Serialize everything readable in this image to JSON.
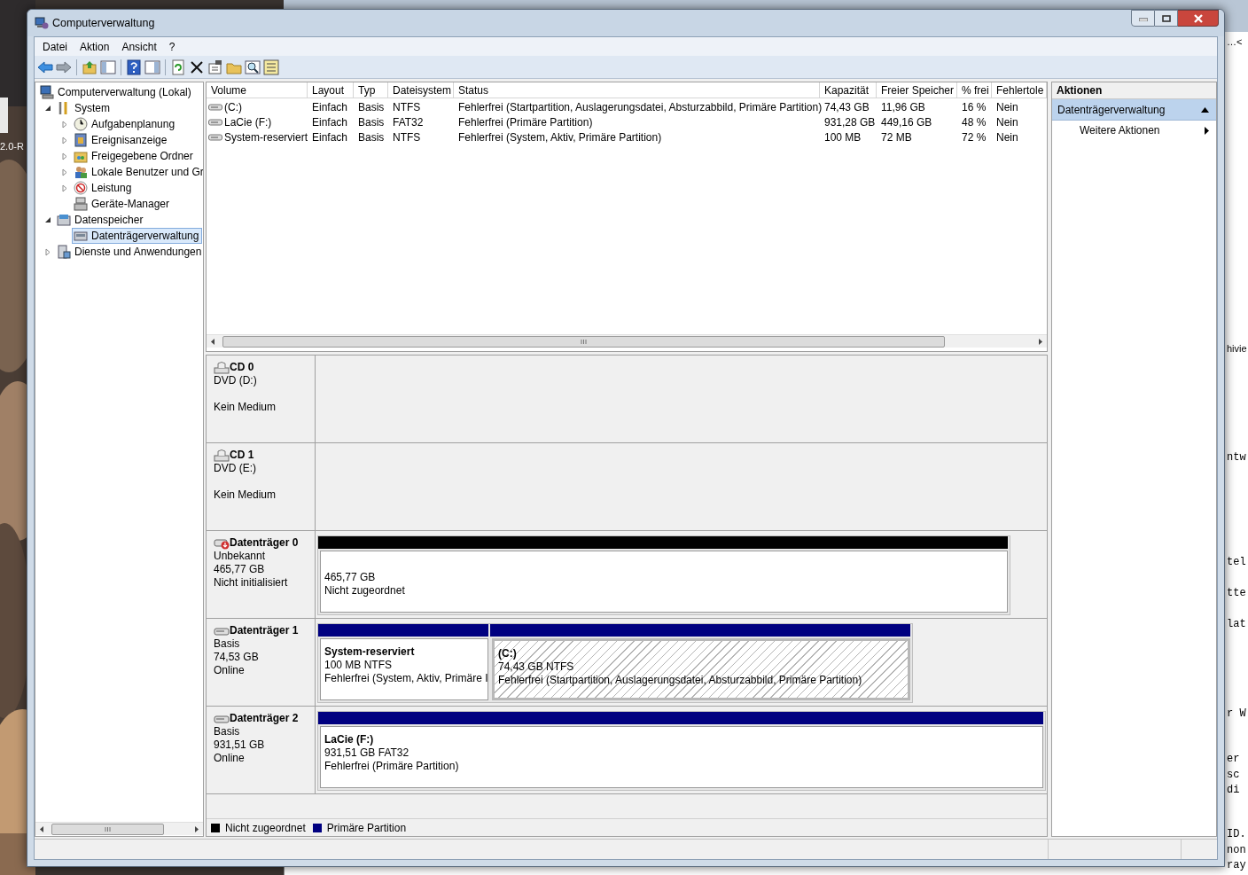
{
  "desktop": {
    "icon_label": "2.0-R"
  },
  "background_window": {
    "fragments": [
      "…<",
      "hivie",
      "ntw",
      "tel",
      "tte",
      "lat",
      "r W",
      "er",
      "sc",
      "di",
      "ID.",
      "non",
      "ray"
    ]
  },
  "window": {
    "title": "Computerverwaltung"
  },
  "menu": [
    "Datei",
    "Aktion",
    "Ansicht",
    "?"
  ],
  "tree": {
    "label": "Computerverwaltung (Lokal)",
    "selected": false,
    "children": [
      {
        "label": "System",
        "expanded": true,
        "selected": false,
        "children": [
          {
            "label": "Aufgabenplanung",
            "expanded": false,
            "selected": false
          },
          {
            "label": "Ereignisanzeige",
            "expanded": false,
            "selected": false
          },
          {
            "label": "Freigegebene Ordner",
            "expanded": false,
            "selected": false
          },
          {
            "label": "Lokale Benutzer und Gr",
            "expanded": false,
            "selected": false
          },
          {
            "label": "Leistung",
            "expanded": false,
            "selected": false
          },
          {
            "label": "Geräte-Manager",
            "selected": false
          }
        ]
      },
      {
        "label": "Datenspeicher",
        "expanded": true,
        "selected": false,
        "children": [
          {
            "label": "Datenträgerverwaltung",
            "selected": true
          }
        ]
      },
      {
        "label": "Dienste und Anwendungen",
        "expanded": false,
        "selected": false
      }
    ]
  },
  "table": {
    "columns": [
      "Volume",
      "Layout",
      "Typ",
      "Dateisystem",
      "Status",
      "Kapazität",
      "Freier Speicher",
      "% frei",
      "Fehlertole"
    ],
    "rows": [
      [
        "(C:)",
        "Einfach",
        "Basis",
        "NTFS",
        "Fehlerfrei (Startpartition, Auslagerungsdatei, Absturzabbild, Primäre Partition)",
        "74,43 GB",
        "11,96 GB",
        "16 %",
        "Nein"
      ],
      [
        "LaCie (F:)",
        "Einfach",
        "Basis",
        "FAT32",
        "Fehlerfrei (Primäre Partition)",
        "931,28 GB",
        "449,16 GB",
        "48 %",
        "Nein"
      ],
      [
        "System-reserviert",
        "Einfach",
        "Basis",
        "NTFS",
        "Fehlerfrei (System, Aktiv, Primäre Partition)",
        "100 MB",
        "72 MB",
        "72 %",
        "Nein"
      ]
    ]
  },
  "disks": [
    {
      "kind": "cd",
      "name": "CD 0",
      "drive": "DVD (D:)",
      "status": "Kein Medium"
    },
    {
      "kind": "cd",
      "name": "CD 1",
      "drive": "DVD (E:)",
      "status": "Kein Medium"
    },
    {
      "kind": "disk",
      "warning": true,
      "name": "Datenträger 0",
      "type": "Unbekannt",
      "size": "465,77 GB",
      "status": "Nicht initialisiert",
      "partitions": [
        {
          "kind": "unallocated",
          "selected": false,
          "size": "465,77 GB",
          "status": "Nicht zugeordnet"
        }
      ]
    },
    {
      "kind": "disk",
      "warning": false,
      "name": "Datenträger 1",
      "type": "Basis",
      "size": "74,53 GB",
      "status": "Online",
      "partitions": [
        {
          "kind": "primary",
          "selected": false,
          "title": "System-reserviert",
          "size": "100 MB NTFS",
          "status": "Fehlerfrei (System, Aktiv, Primäre I"
        },
        {
          "kind": "primary",
          "selected": true,
          "title": "(C:)",
          "size": "74,43 GB NTFS",
          "status": "Fehlerfrei (Startpartition, Auslagerungsdatei, Absturzabbild, Primäre Partition)"
        }
      ]
    },
    {
      "kind": "disk",
      "warning": false,
      "name": "Datenträger 2",
      "type": "Basis",
      "size": "931,51 GB",
      "status": "Online",
      "partitions": [
        {
          "kind": "primary",
          "selected": false,
          "title": "LaCie  (F:)",
          "size": "931,51 GB FAT32",
          "status": "Fehlerfrei (Primäre Partition)"
        }
      ]
    }
  ],
  "legend": [
    {
      "label": "Nicht zugeordnet",
      "color": "#000000"
    },
    {
      "label": "Primäre Partition",
      "color": "#000080"
    }
  ],
  "actions": {
    "title": "Aktionen",
    "sections": [
      {
        "label": "Datenträgerverwaltung",
        "expanded": true,
        "items": [
          "Weitere Aktionen"
        ]
      }
    ]
  }
}
